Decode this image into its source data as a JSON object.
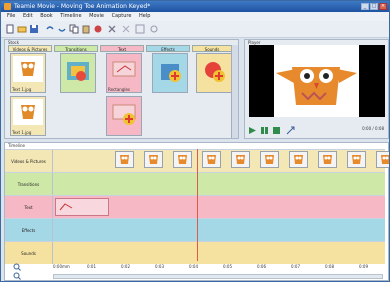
{
  "window": {
    "title": "Teamie Movie - Moving Toe Animation Keyed*"
  },
  "menu": [
    "File",
    "Edit",
    "Book",
    "Timeline",
    "Movie",
    "Capture",
    "Help"
  ],
  "library": {
    "label": "Stock",
    "categories": [
      "Videos & Pictures",
      "Transitions",
      "Text",
      "Effects",
      "Sounds"
    ],
    "items": [
      {
        "caption": "Text 1.jpg"
      },
      {
        "caption": ""
      },
      {
        "caption": "Rectangles"
      },
      {
        "caption": ""
      },
      {
        "caption": ""
      },
      {
        "caption": "Text 1.jpg"
      },
      {
        "caption": ""
      }
    ]
  },
  "preview": {
    "label": "Player",
    "counter": "0:00 / 0:08"
  },
  "timeline": {
    "label": "Timeline",
    "tracks": [
      "Videos & Pictures",
      "Transitions",
      "Text",
      "Effects",
      "Sounds"
    ],
    "ruler": [
      "0:00mm",
      "0:01",
      "0:02",
      "0:03",
      "0:04",
      "0:05",
      "0:06",
      "0:07",
      "0:08",
      "0:09"
    ]
  },
  "colors": {
    "titlebar": "#2a63b4",
    "video": "#f3e7b6",
    "transitions": "#cde8a7",
    "text": "#f5b8c4",
    "effects": "#a5d8e6",
    "sounds": "#f5e2a0"
  }
}
